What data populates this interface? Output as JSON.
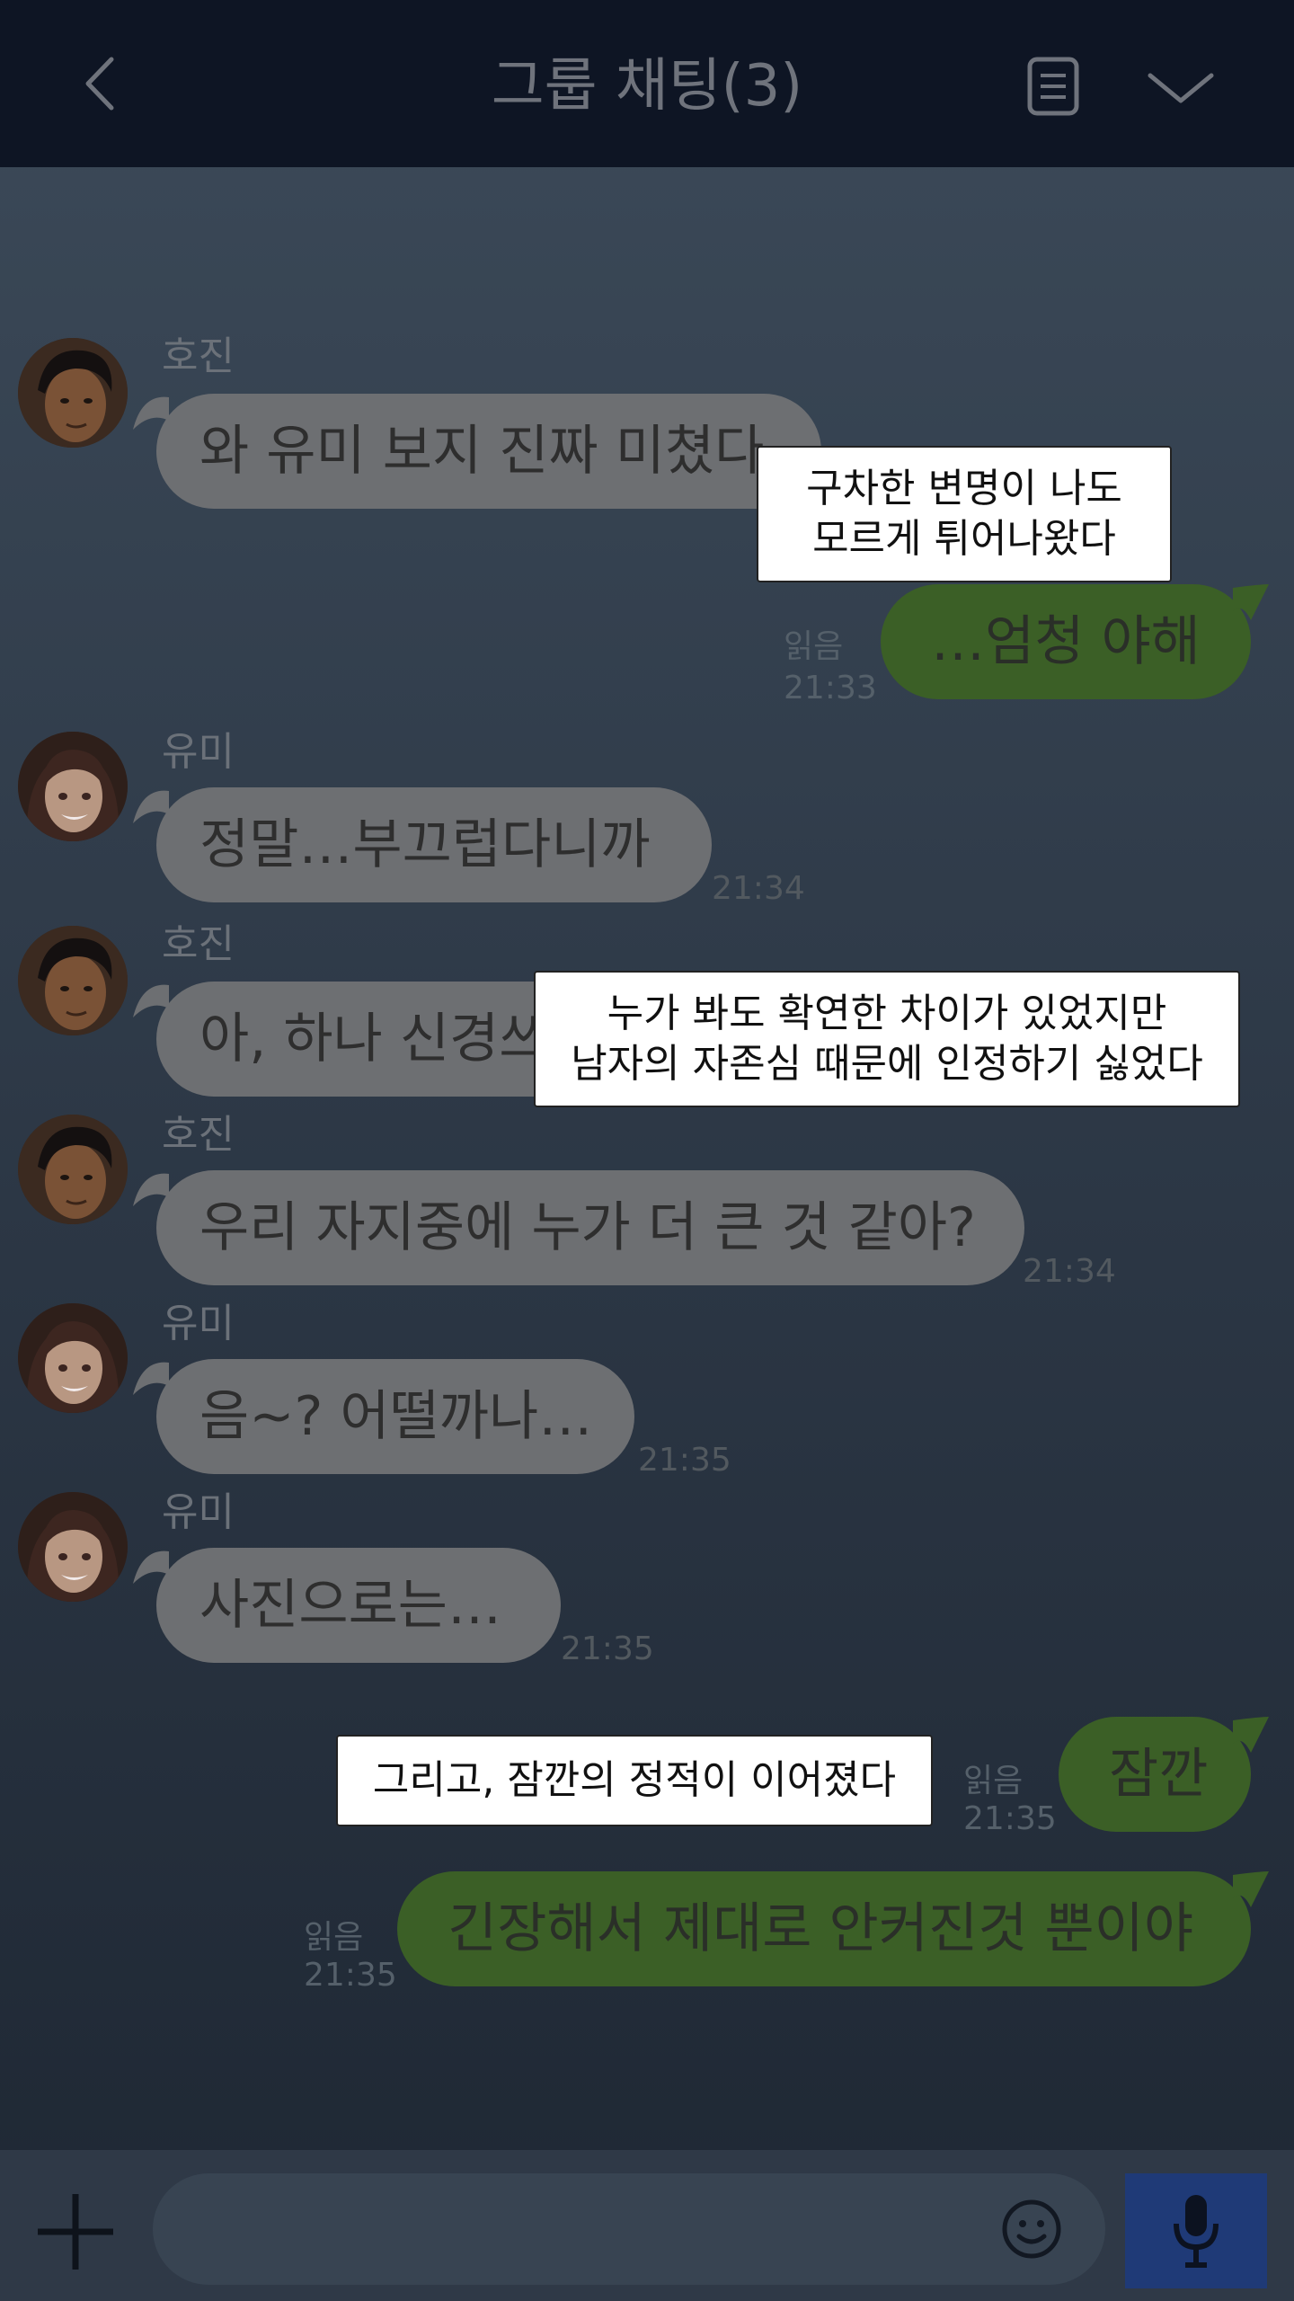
{
  "header": {
    "title": "그룹 채팅(3)",
    "back_icon": "chevron-left-icon",
    "menu_icon": "document-icon",
    "expand_icon": "chevron-down-icon"
  },
  "messages": [
    {
      "sender": "호진",
      "text": "와 유미 보지 진짜 미쳤다"
    },
    {
      "text": "…엄청 야해",
      "read": "읽음",
      "time": "21:33"
    },
    {
      "sender": "유미",
      "text": "정말…부끄럽다니까",
      "time": "21:34"
    },
    {
      "sender": "호진",
      "text": "아, 하나 신경쓰"
    },
    {
      "sender": "호진",
      "text": "우리 자지중에 누가 더 큰 것 같아?",
      "time": "21:34"
    },
    {
      "sender": "유미",
      "text": "음~? 어떨까나…",
      "time": "21:35"
    },
    {
      "sender": "유미",
      "text": "사진으로는…",
      "time": "21:35"
    },
    {
      "text": "잠깐",
      "read": "읽음",
      "time": "21:35"
    },
    {
      "text": "긴장해서 제대로 안커진것 뿐이야",
      "read": "읽음",
      "time": "21:35"
    }
  ],
  "captions": [
    {
      "line1": "구차한 변명이 나도",
      "line2": "모르게 튀어나왔다"
    },
    {
      "line1": "누가 봐도 확연한 차이가 있었지만",
      "line2": "남자의 자존심 때문에 인정하기 싫었다"
    },
    {
      "line1": "그리고, 잠깐의 정적이 이어졌다"
    }
  ],
  "input_bar": {
    "plus_icon": "plus-icon",
    "emoji_icon": "smiley-icon",
    "mic_icon": "microphone-icon",
    "placeholder": ""
  },
  "colors": {
    "header_bg": "#0e1524",
    "chat_bg": "#3c4a59",
    "bubble_received": "#6d6f72",
    "bubble_sent": "#3b5f26",
    "mic_button": "#1f3a77"
  }
}
